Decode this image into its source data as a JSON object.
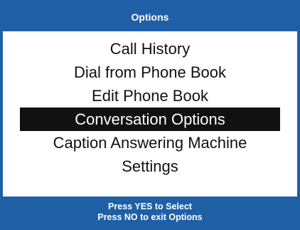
{
  "header": {
    "title": "Options"
  },
  "menu": {
    "items": [
      {
        "label": "Call History"
      },
      {
        "label": "Dial from Phone Book"
      },
      {
        "label": "Edit Phone Book"
      },
      {
        "label": "Conversation Options"
      },
      {
        "label": "Caption Answering Machine"
      },
      {
        "label": "Settings"
      }
    ],
    "selected": "Conversation Options"
  },
  "footer": {
    "line1": "Press YES to Select",
    "line2": "Press NO to exit Options"
  },
  "colors": {
    "accent": "#1f5fa6",
    "selection_background": "#111111",
    "selection_text": "#ffffff"
  }
}
